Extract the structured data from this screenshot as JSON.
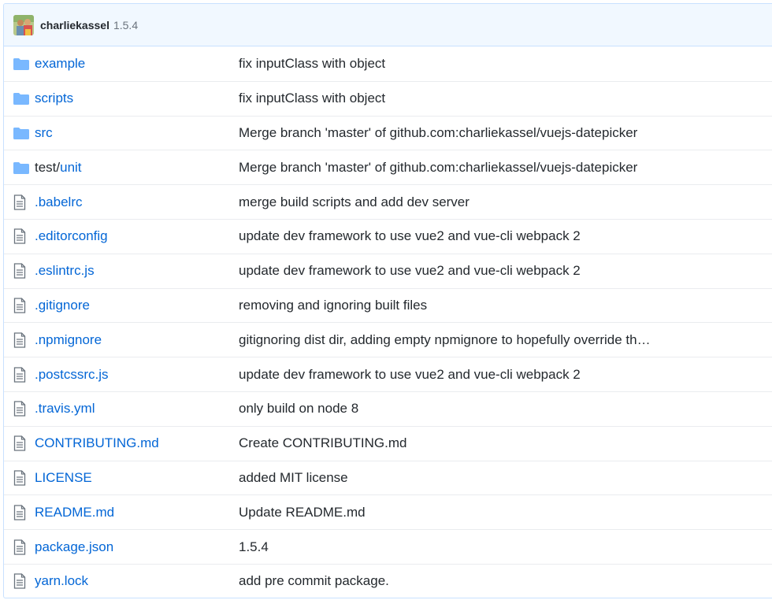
{
  "commit": {
    "author": "charliekassel",
    "version": "1.5.4"
  },
  "colors": {
    "link": "#0366d6",
    "folder_icon": "#79b8ff",
    "file_icon": "#6a737d",
    "header_bg": "#f1f8ff",
    "border": "#c8e1ff"
  },
  "files": [
    {
      "type": "folder",
      "icon": "folder-icon",
      "prefix": "",
      "name": "example",
      "message": "fix inputClass with object"
    },
    {
      "type": "folder",
      "icon": "folder-icon",
      "prefix": "",
      "name": "scripts",
      "message": "fix inputClass with object"
    },
    {
      "type": "folder",
      "icon": "folder-icon",
      "prefix": "",
      "name": "src",
      "message": "Merge branch 'master' of github.com:charliekassel/vuejs-datepicker"
    },
    {
      "type": "folder",
      "icon": "folder-icon",
      "prefix": "test/",
      "name": "unit",
      "message": "Merge branch 'master' of github.com:charliekassel/vuejs-datepicker"
    },
    {
      "type": "file",
      "icon": "file-icon",
      "prefix": "",
      "name": ".babelrc",
      "message": "merge build scripts and add dev server"
    },
    {
      "type": "file",
      "icon": "file-icon",
      "prefix": "",
      "name": ".editorconfig",
      "message": "update dev framework to use vue2 and vue-cli webpack 2"
    },
    {
      "type": "file",
      "icon": "file-icon",
      "prefix": "",
      "name": ".eslintrc.js",
      "message": "update dev framework to use vue2 and vue-cli webpack 2"
    },
    {
      "type": "file",
      "icon": "file-icon",
      "prefix": "",
      "name": ".gitignore",
      "message": "removing and ignoring built files"
    },
    {
      "type": "file",
      "icon": "file-icon",
      "prefix": "",
      "name": ".npmignore",
      "message": "gitignoring dist dir, adding empty npmignore to hopefully override th…"
    },
    {
      "type": "file",
      "icon": "file-icon",
      "prefix": "",
      "name": ".postcssrc.js",
      "message": "update dev framework to use vue2 and vue-cli webpack 2"
    },
    {
      "type": "file",
      "icon": "file-icon",
      "prefix": "",
      "name": ".travis.yml",
      "message": "only build on node 8"
    },
    {
      "type": "file",
      "icon": "file-icon",
      "prefix": "",
      "name": "CONTRIBUTING.md",
      "message": "Create CONTRIBUTING.md"
    },
    {
      "type": "file",
      "icon": "file-icon",
      "prefix": "",
      "name": "LICENSE",
      "message": "added MIT license"
    },
    {
      "type": "file",
      "icon": "file-icon",
      "prefix": "",
      "name": "README.md",
      "message": "Update README.md"
    },
    {
      "type": "file",
      "icon": "file-icon",
      "prefix": "",
      "name": "package.json",
      "message": "1.5.4"
    },
    {
      "type": "file",
      "icon": "file-icon",
      "prefix": "",
      "name": "yarn.lock",
      "message": "add pre commit package."
    }
  ]
}
